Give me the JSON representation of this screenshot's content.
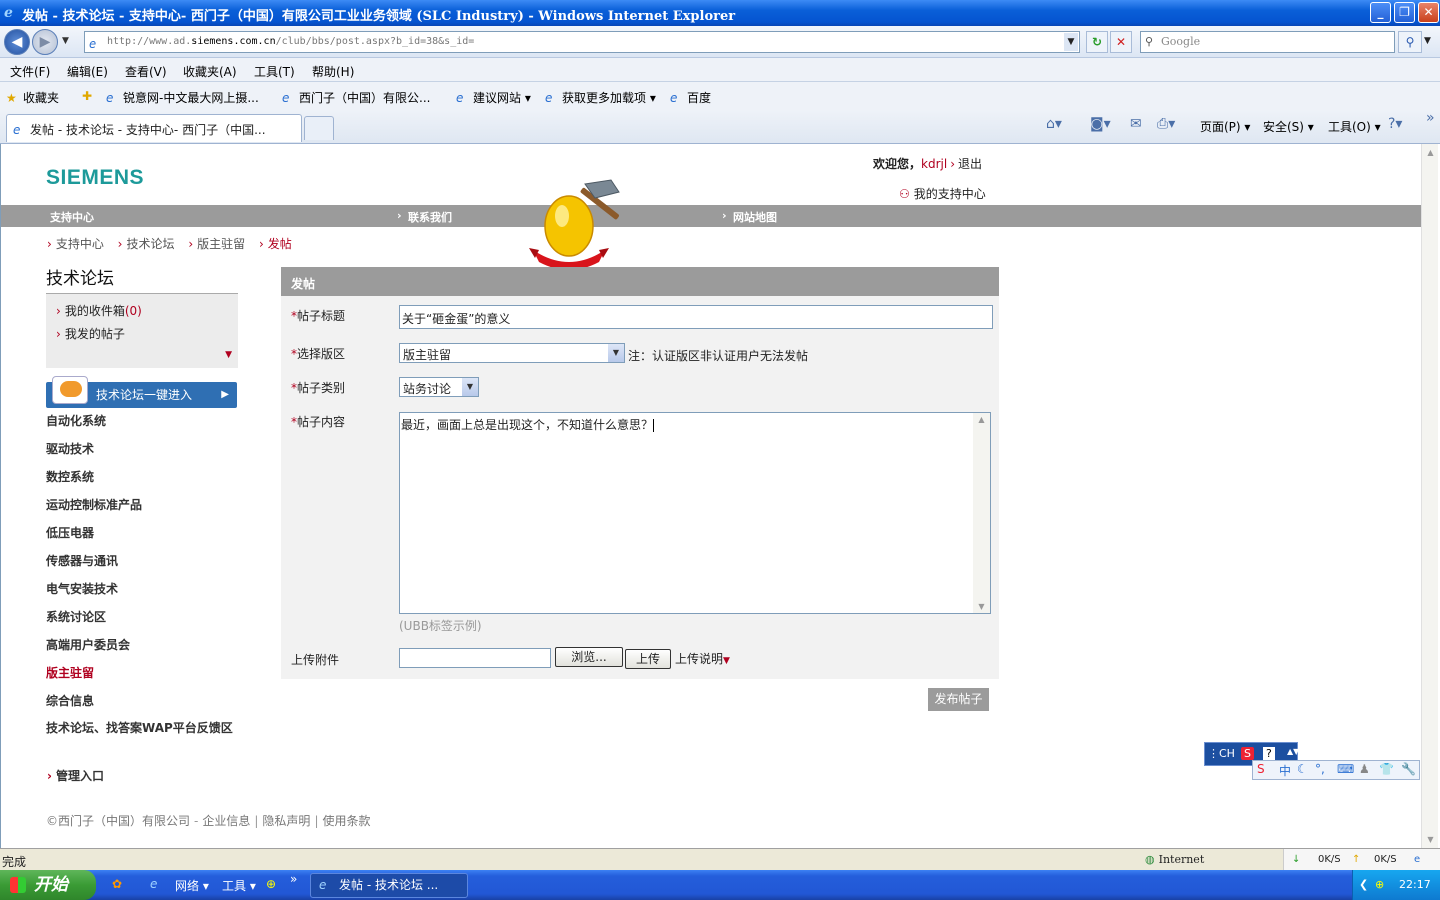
{
  "window": {
    "title": "发帖 - 技术论坛 - 支持中心- 西门子（中国）有限公司工业业务领域 (SLC Industry) - Windows Internet Explorer",
    "btn_min": "_",
    "btn_max": "❐",
    "btn_close": "✕"
  },
  "browser": {
    "url_prefix": "http://www.ad.",
    "url_domain": "siemens.com.cn",
    "url_suffix": "/club/bbs/post.aspx?b_id=38&s_id=",
    "search_placeholder": "Google",
    "menu": [
      "文件(F)",
      "编辑(E)",
      "查看(V)",
      "收藏夹(A)",
      "工具(T)",
      "帮助(H)"
    ],
    "favorites_label": "收藏夹",
    "favorites": [
      "锐意网-中文最大网上摄...",
      "西门子（中国）有限公...",
      "建议网站 ▾",
      "获取更多加载项 ▾",
      "百度"
    ],
    "tab_title": "发帖 - 技术论坛 - 支持中心- 西门子（中国...",
    "cmd_page": "页面(P) ▾",
    "cmd_safety": "安全(S) ▾",
    "cmd_tools": "工具(O) ▾",
    "status_done": "完成",
    "status_zone": "Internet",
    "net_down": "0K/S",
    "net_up": "0K/S"
  },
  "site": {
    "logo": "SIEMENS",
    "welcome_prefix": "欢迎您，",
    "username": "kdrjl",
    "logout": "退出",
    "my_support": "我的支持中心",
    "topnav": [
      "支持中心",
      "联系我们",
      "网站地图"
    ],
    "breadcrumb": [
      "支持中心",
      "技术论坛",
      "版主驻留",
      "发帖"
    ],
    "left_title": "技术论坛",
    "inbox_label": "我的收件箱",
    "inbox_count": "(0)",
    "my_posts": "我发的帖子",
    "oneclick": "技术论坛一键进入",
    "categories": [
      "自动化系统",
      "驱动技术",
      "数控系统",
      "运动控制标准产品",
      "低压电器",
      "传感器与通讯",
      "电气安装技术",
      "系统讨论区",
      "高端用户委员会",
      "版主驻留",
      "综合信息",
      "技术论坛、找答案WAP平台反馈区"
    ],
    "mgmt": "管理入口"
  },
  "form": {
    "header": "发帖",
    "subject_label": "帖子标题",
    "subject_value": "关于“砸金蛋”的意义",
    "board_label": "选择版区",
    "board_value": "版主驻留",
    "board_note": "注：认证版区非认证用户无法发帖",
    "type_label": "帖子类别",
    "type_value": "站务讨论",
    "content_label": "帖子内容",
    "content_value": "最近，画面上总是出现这个，不知道什么意思？",
    "ubb": "(UBB标签示例)",
    "attach_label": "上传附件",
    "browse": "浏览...",
    "upload": "上传",
    "upload_note": "上传说明",
    "submit": "发布帖子",
    "required_mark": "*"
  },
  "footer": {
    "copyright": "©西门子（中国）有限公司",
    "links": [
      "企业信息",
      "隐私声明",
      "使用条款"
    ]
  },
  "ime": {
    "lang": "CH",
    "s_icon": "S",
    "help": "?"
  },
  "taskbar": {
    "start": "开始",
    "net": "网络 ▾",
    "tools": "工具 ▾",
    "more": "»",
    "task": "发帖 - 技术论坛 ...",
    "clock": "22:17"
  }
}
